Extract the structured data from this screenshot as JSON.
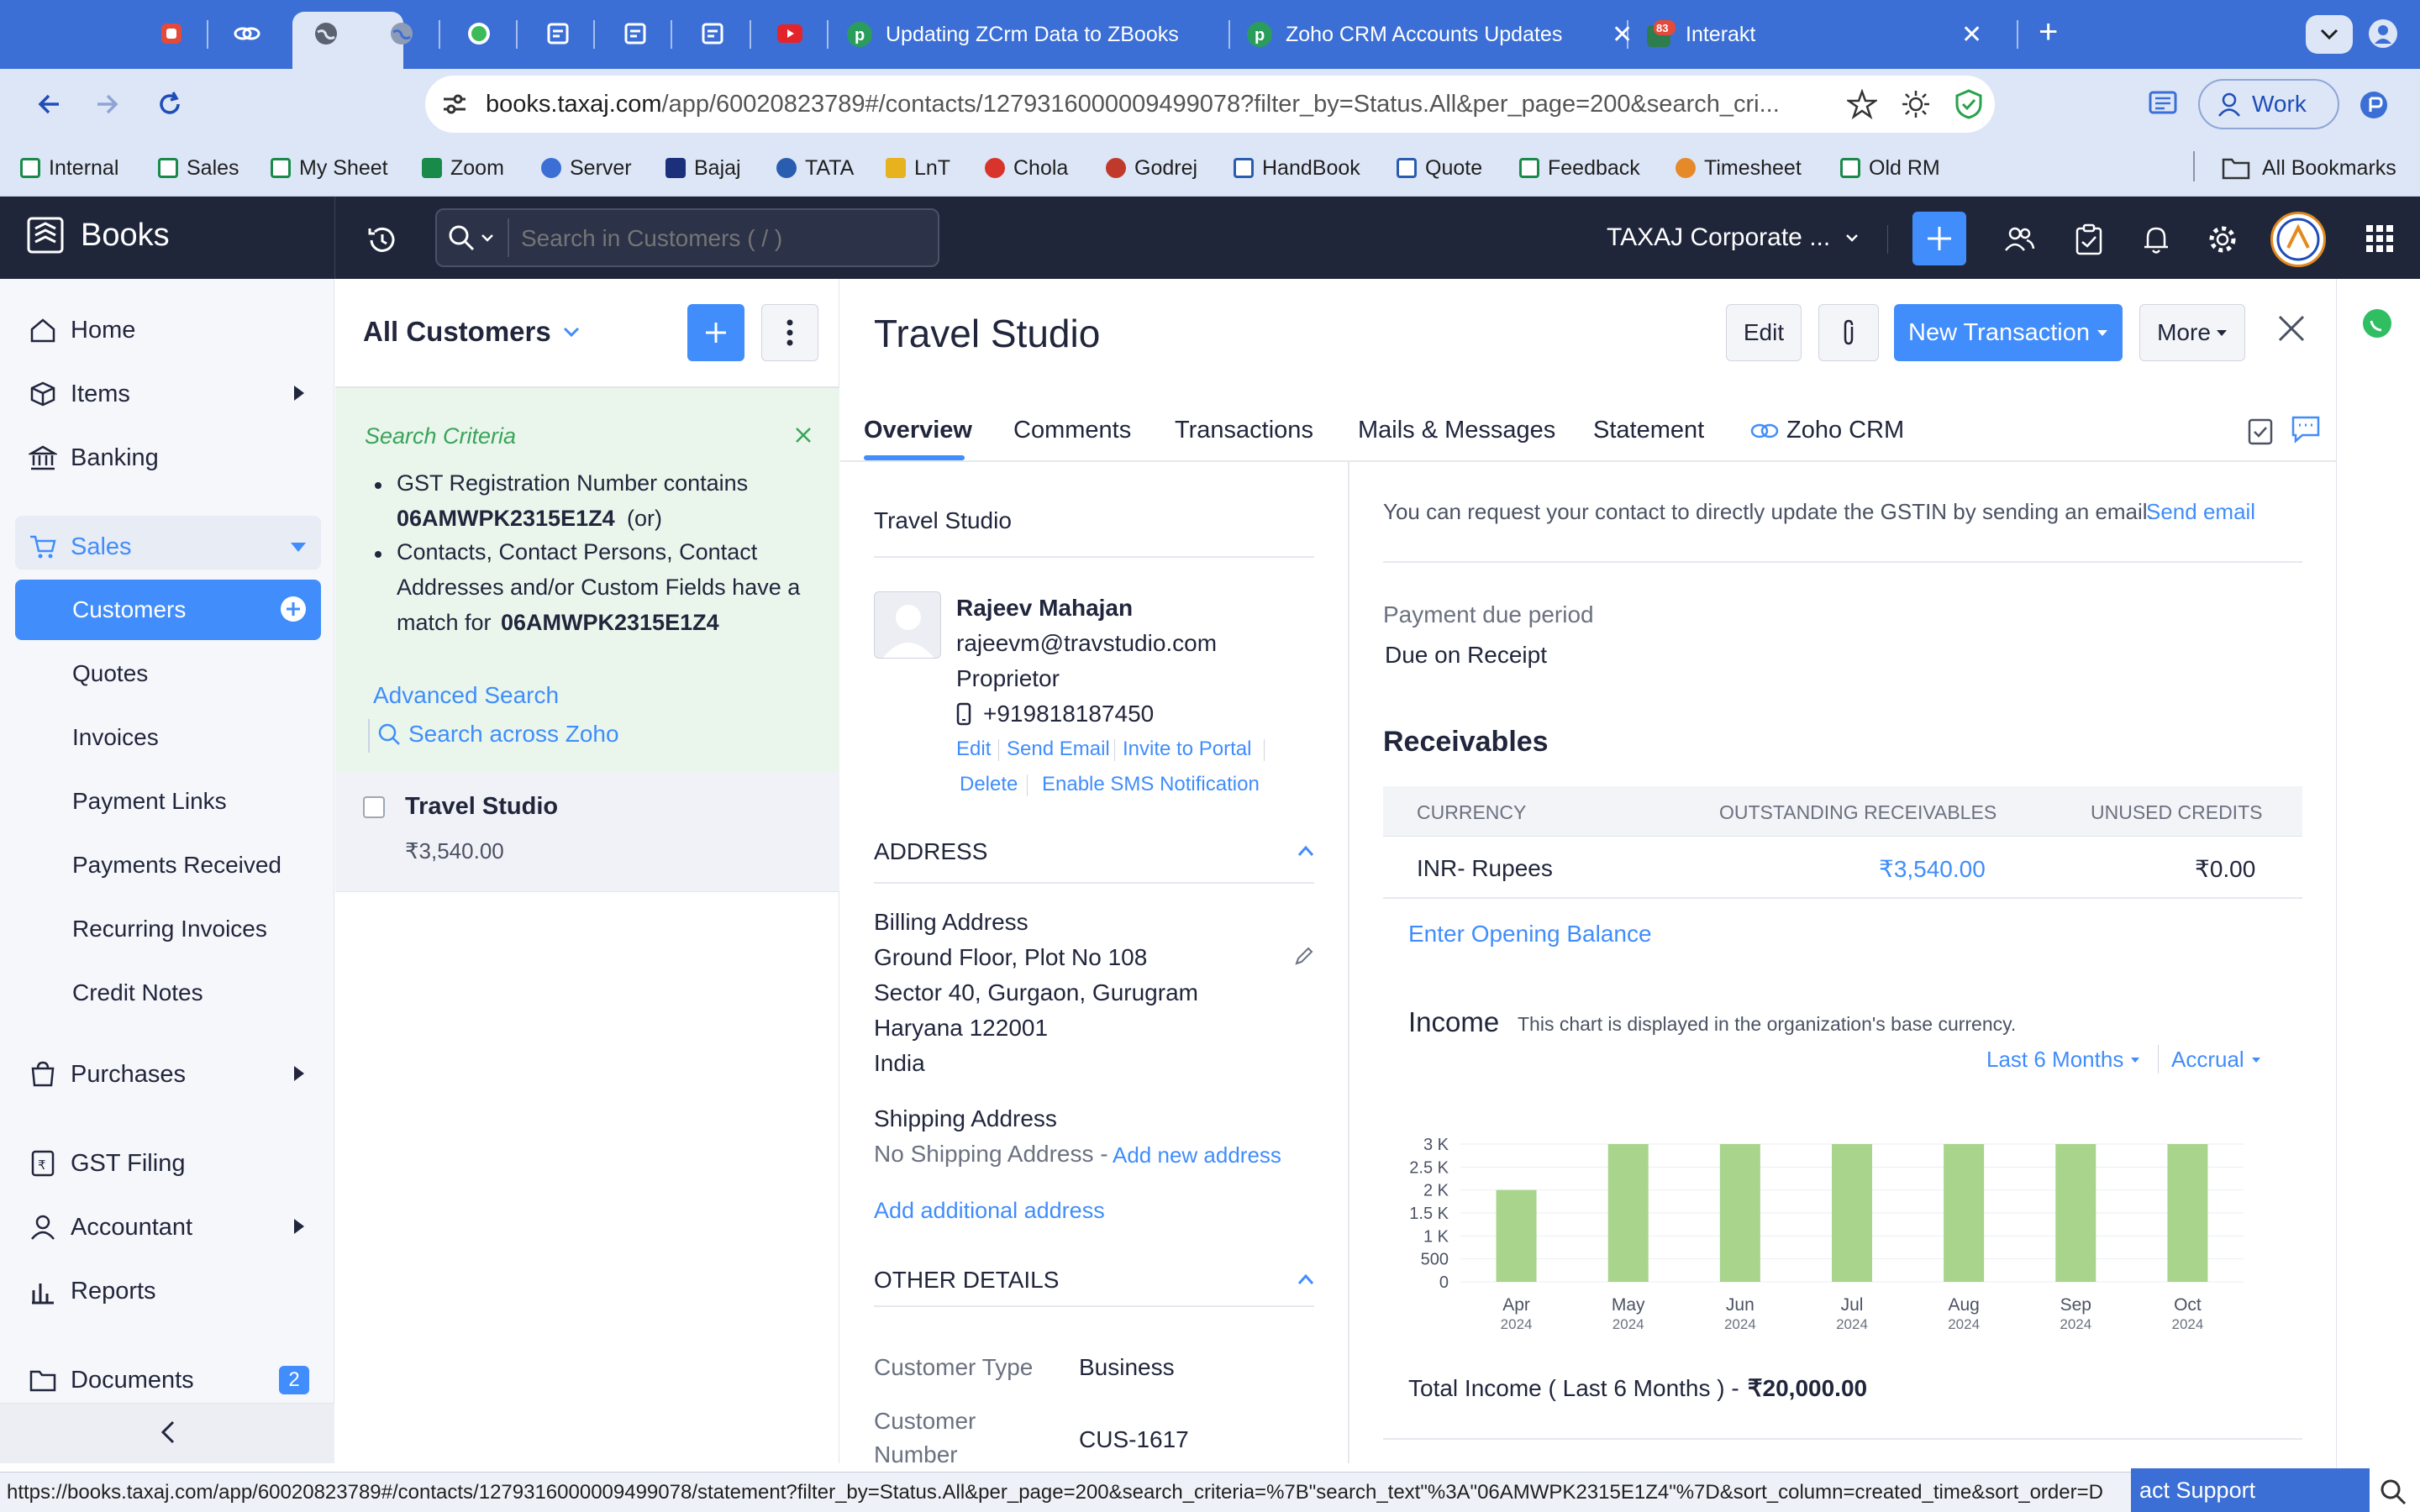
{
  "browser": {
    "tabs": [
      {
        "title": "Updating ZCrm Data to ZBooks"
      },
      {
        "title": "Zoho CRM Accounts Updates"
      },
      {
        "title": "Interakt",
        "badge": "83"
      }
    ],
    "url_host": "books.taxaj.com",
    "url_path": "/app/60020823789#/contacts/1279316000009499078?filter_by=Status.All&per_page=200&search_cri...",
    "profile_label": "Work",
    "bookmarks": [
      "Internal",
      "Sales",
      "My Sheet",
      "Zoom",
      "Server",
      "Bajaj",
      "TATA",
      "LnT",
      "Chola",
      "Godrej",
      "HandBook",
      "Quote",
      "Feedback",
      "Timesheet",
      "Old RM"
    ],
    "all_bookmarks": "All Bookmarks",
    "status_url": "https://books.taxaj.com/app/60020823789#/contacts/1279316000009499078/statement?filter_by=Status.All&per_page=200&search_criteria=%7B\"search_text\"%3A\"06AMWPK2315E1Z4\"%7D&sort_column=created_time&sort_order=D",
    "support_label": "act Support"
  },
  "app": {
    "name": "Books",
    "search_placeholder": "Search in Customers ( / )",
    "org_name": "TAXAJ Corporate ...",
    "accent": "#408dfb"
  },
  "sidebar": {
    "home": "Home",
    "items": "Items",
    "banking": "Banking",
    "sales": "Sales",
    "sales_children": [
      "Customers",
      "Quotes",
      "Invoices",
      "Payment Links",
      "Payments Received",
      "Recurring Invoices",
      "Credit Notes"
    ],
    "purchases": "Purchases",
    "gst_filing": "GST Filing",
    "accountant": "Accountant",
    "reports": "Reports",
    "documents": "Documents",
    "documents_count": "2"
  },
  "list": {
    "view_title": "All Customers",
    "criteria_title": "Search Criteria",
    "criteria_1": "GST Registration Number contains",
    "criteria_1_value": "06AMWPK2315E1Z4",
    "criteria_1_suffix": "(or)",
    "criteria_2_line1": "Contacts, Contact Persons, Contact",
    "criteria_2_line2": "Addresses and/or Custom Fields have a",
    "criteria_2_line3": "match for",
    "criteria_2_value": "06AMWPK2315E1Z4",
    "advanced_search": "Advanced Search",
    "search_zoho": "Search across Zoho",
    "rows": [
      {
        "name": "Travel Studio",
        "amount": "₹3,540.00"
      }
    ]
  },
  "detail": {
    "title": "Travel Studio",
    "edit": "Edit",
    "new_transaction": "New Transaction",
    "more": "More",
    "tabs": [
      "Overview",
      "Comments",
      "Transactions",
      "Mails & Messages",
      "Statement",
      "Zoho CRM"
    ],
    "contact": {
      "company": "Travel Studio",
      "name": "Rajeev Mahajan",
      "email": "rajeevm@travstudio.com",
      "designation": "Proprietor",
      "phone": "+919818187450",
      "actions": [
        "Edit",
        "Send Email",
        "Invite to Portal",
        "Delete",
        "Enable SMS Notification"
      ]
    },
    "address_heading": "ADDRESS",
    "billing_label": "Billing Address",
    "billing_lines": [
      "Ground Floor, Plot No 108",
      "Sector 40, Gurgaon, Gurugram",
      "Haryana 122001",
      "India"
    ],
    "shipping_label": "Shipping Address",
    "shipping_none": "No Shipping Address -",
    "add_new_address": "Add new address",
    "add_additional": "Add additional address",
    "other_heading": "OTHER DETAILS",
    "customer_type_label": "Customer Type",
    "customer_type": "Business",
    "customer_number_label_1": "Customer",
    "customer_number_label_2": "Number",
    "customer_number": "CUS-1617",
    "gstin_note": "You can request your contact to directly update the GSTIN by sending an email.",
    "send_email": "Send email",
    "payment_due_label": "Payment due period",
    "payment_due": "Due on Receipt",
    "receivables_heading": "Receivables",
    "receivables_cols": [
      "CURRENCY",
      "OUTSTANDING RECEIVABLES",
      "UNUSED CREDITS"
    ],
    "receivables_row": {
      "currency": "INR- Rupees",
      "outstanding": "₹3,540.00",
      "unused": "₹0.00"
    },
    "opening_balance": "Enter Opening Balance",
    "income_title": "Income",
    "income_note": "This chart is displayed in the organization's base currency.",
    "period": "Last 6 Months",
    "basis": "Accrual",
    "total_income_label": "Total Income ( Last 6 Months ) -",
    "total_income": "₹20,000.00"
  },
  "chart_data": {
    "type": "bar",
    "categories": [
      "Apr",
      "May",
      "Jun",
      "Jul",
      "Aug",
      "Sep",
      "Oct"
    ],
    "years": [
      "2024",
      "2024",
      "2024",
      "2024",
      "2024",
      "2024",
      "2024"
    ],
    "values": [
      2000,
      3000,
      3000,
      3000,
      3000,
      3000,
      3000
    ],
    "ylim": [
      0,
      3000
    ],
    "yticks": [
      0,
      500,
      1000,
      1500,
      2000,
      2500,
      3000
    ],
    "ytick_labels": [
      "0",
      "500",
      "1 K",
      "1.5 K",
      "2 K",
      "2.5 K",
      "3 K"
    ],
    "bar_color": "#a8d48c",
    "grid": true
  }
}
